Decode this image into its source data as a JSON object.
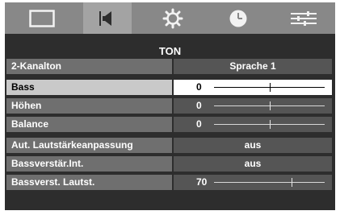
{
  "tabs": [
    {
      "icon": "picture-icon",
      "active": false
    },
    {
      "icon": "speaker-icon",
      "active": true
    },
    {
      "icon": "gear-icon",
      "active": false
    },
    {
      "icon": "clock-icon",
      "active": false
    },
    {
      "icon": "sliders-icon",
      "active": false
    }
  ],
  "menu": {
    "title": "TON",
    "rows": [
      {
        "label": "2-Kanalton",
        "value": "Sprache 1"
      },
      {
        "label": "Bass",
        "value": "0",
        "level": 0.5
      },
      {
        "label": "Höhen",
        "value": "0",
        "level": 0.5
      },
      {
        "label": "Balance",
        "value": "0",
        "level": 0.5
      },
      {
        "label": "Aut. Lautstärkeanpassung",
        "value": "aus"
      },
      {
        "label": "Bassverstär.Int.",
        "value": "aus"
      },
      {
        "label": "Bassverst. Lautst.",
        "value": "70",
        "level": 0.7
      }
    ],
    "selected_row": "Bass"
  }
}
